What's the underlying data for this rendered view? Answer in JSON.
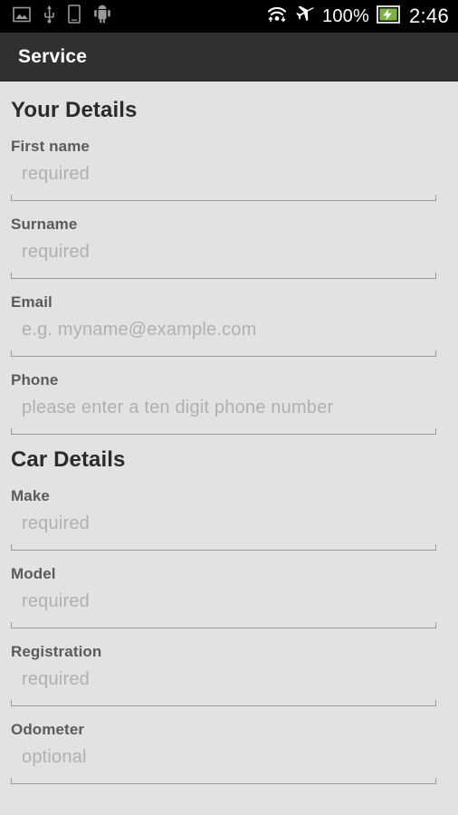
{
  "status_bar": {
    "left_icons": [
      {
        "name": "image-icon",
        "label": "image"
      },
      {
        "name": "usb-icon",
        "label": "usb"
      },
      {
        "name": "device-icon",
        "label": "device"
      },
      {
        "name": "android-icon",
        "label": "android"
      }
    ],
    "right_icons": [
      {
        "name": "wifi-sync-icon",
        "label": "wifi"
      },
      {
        "name": "airplane-mode-icon",
        "label": "airplane mode"
      },
      {
        "name": "battery-charging-icon",
        "label": "battery charging"
      }
    ],
    "battery_level": "100%",
    "clock": "2:46",
    "battery_fill_color": "#7cb342",
    "text_color": "#ffffff",
    "background_color": "#000000"
  },
  "app_bar": {
    "title": "Service",
    "background_color": "#303030",
    "title_color": "#ffffff"
  },
  "form": {
    "background_color": "#e2e2e2",
    "sections": [
      {
        "id": "your-details",
        "title": "Your Details",
        "fields": [
          {
            "id": "first-name",
            "label": "First name",
            "value": "",
            "placeholder": "required"
          },
          {
            "id": "surname",
            "label": "Surname",
            "value": "",
            "placeholder": "required"
          },
          {
            "id": "email",
            "label": "Email",
            "value": "",
            "placeholder": "e.g. myname@example.com"
          },
          {
            "id": "phone",
            "label": "Phone",
            "value": "",
            "placeholder": "please enter a ten digit phone number"
          }
        ]
      },
      {
        "id": "car-details",
        "title": "Car Details",
        "fields": [
          {
            "id": "make",
            "label": "Make",
            "value": "",
            "placeholder": "required"
          },
          {
            "id": "model",
            "label": "Model",
            "value": "",
            "placeholder": "required"
          },
          {
            "id": "registration",
            "label": "Registration",
            "value": "",
            "placeholder": "required"
          },
          {
            "id": "odometer",
            "label": "Odometer",
            "value": "",
            "placeholder": "optional"
          }
        ]
      }
    ]
  }
}
